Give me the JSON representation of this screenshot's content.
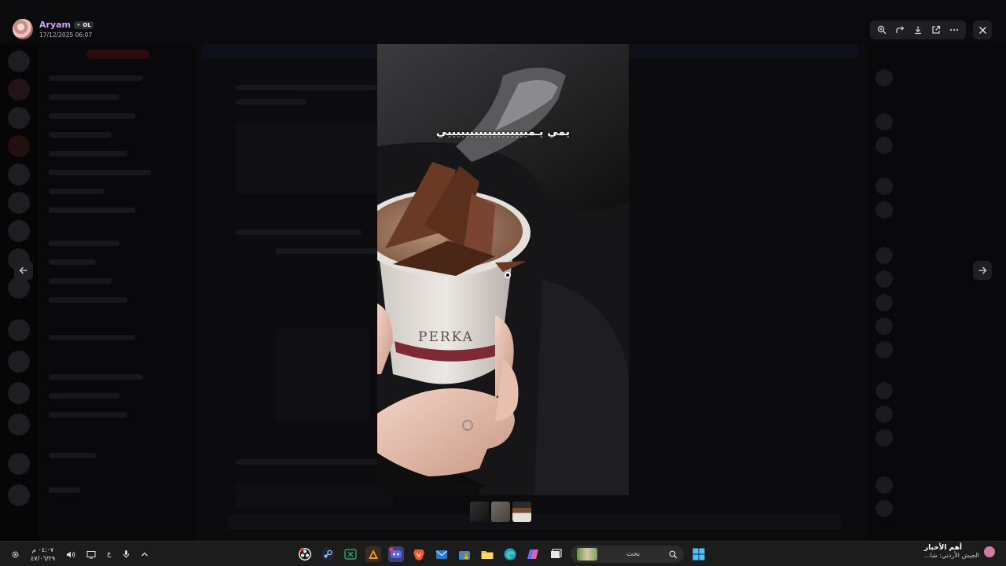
{
  "viewer": {
    "uploader_name": "Aryam",
    "uploader_badge": "OL",
    "upload_date": "17/12/2025 06:07",
    "photo_caption": "يمي يـمييييييييييييييييييي",
    "photo_cup_brand": "PERKA"
  },
  "toolbar": {
    "zoom_icon": "zoom-in-icon",
    "forward_icon": "forward-icon",
    "download_icon": "download-icon",
    "open_icon": "open-external-icon",
    "more_icon": "more-icon",
    "close_icon": "close-icon"
  },
  "taskbar": {
    "clock_time": "٠٤:٠٧ م",
    "clock_date": "٤٧/٠٦/٢٩",
    "lang": "ع",
    "search_placeholder": "بحث",
    "news_title": "أهم الأخبار",
    "news_sub": "الجيش الأردني: شا..."
  },
  "colors": {
    "accent_username": "#c9a2f0",
    "toolbar_bg": "#1e1f22",
    "taskbar_bg": "#1c1c1c"
  }
}
